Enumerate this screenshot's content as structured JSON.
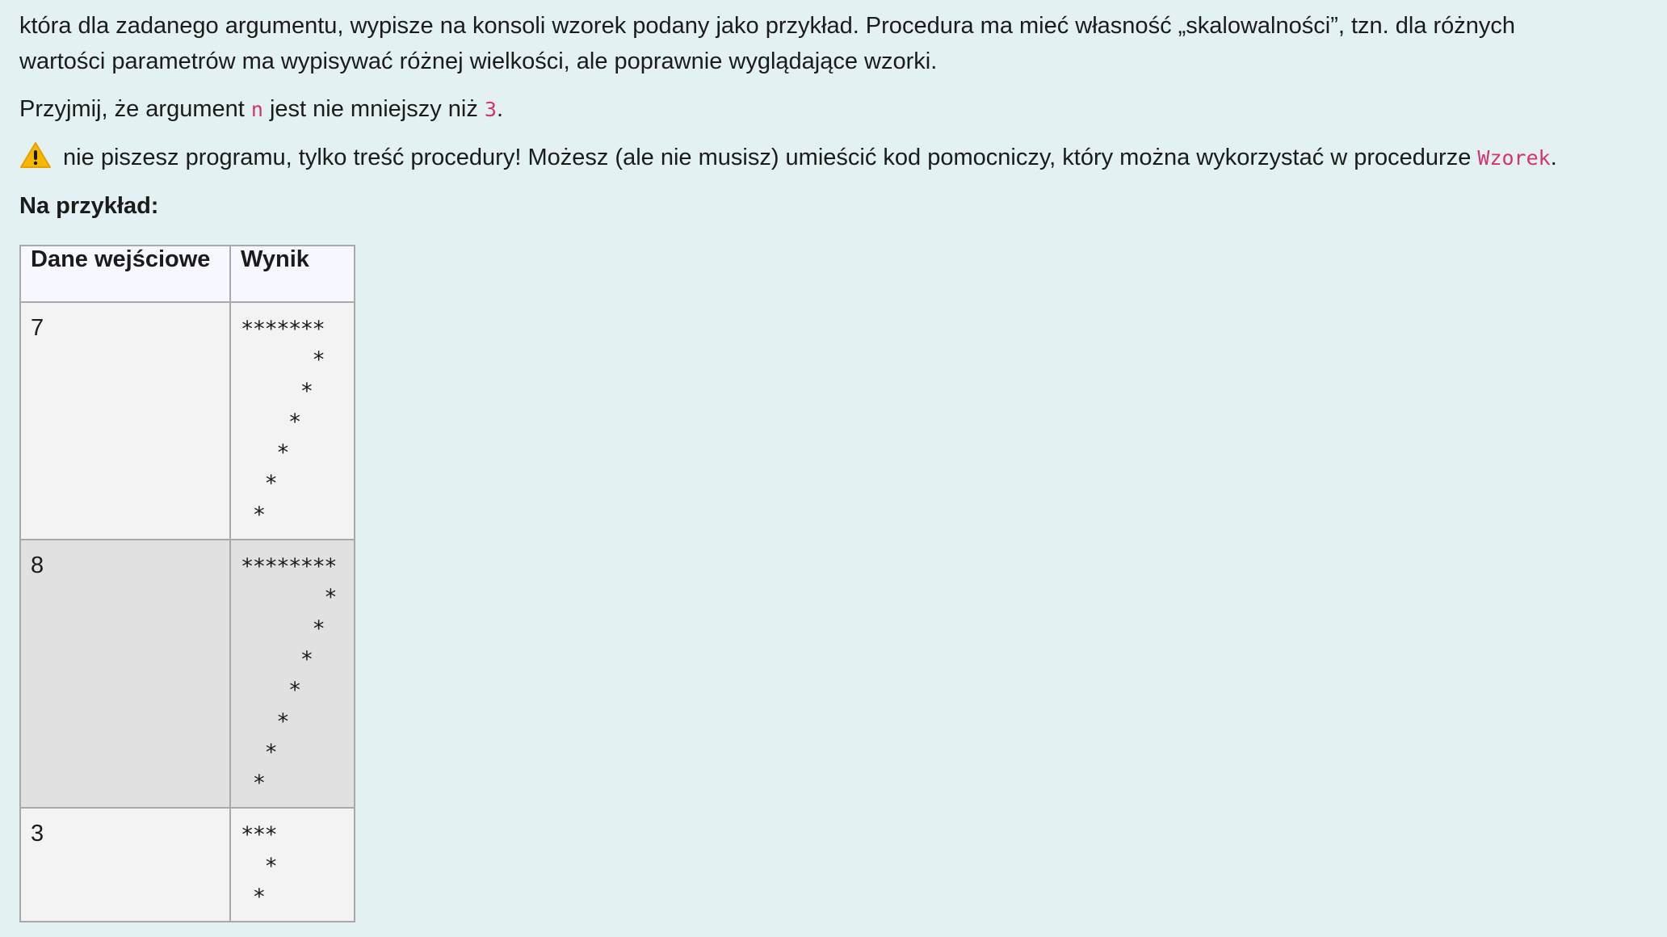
{
  "intro": {
    "line1": "która dla zadanego argumentu, wypisze na konsoli wzorek podany jako przykład. Procedura ma mieć własność „skalowalności”, tzn. dla różnych",
    "line2": "wartości parametrów ma wypisywać różnej wielkości, ale poprawnie wyglądające wzorki."
  },
  "assumption": {
    "before": "Przyjmij, że argument ",
    "code1": "n",
    "middle": " jest nie mniejszy niż ",
    "code2": "3",
    "after": "."
  },
  "warning": {
    "icon": "warning-icon",
    "text": " nie piszesz programu, tylko treść procedury! Możesz (ale nie musisz) umieścić kod pomocniczy, który można wykorzystać w procedurze ",
    "code": "Wzorek",
    "after": "."
  },
  "example_heading": "Na przykład:",
  "table": {
    "headers": [
      "Dane wejściowe",
      "Wynik"
    ],
    "rows": [
      {
        "input": "7",
        "output": "*******\n      *\n     *\n    *\n   *\n  *\n *"
      },
      {
        "input": "8",
        "output": "********\n       *\n      *\n     *\n    *\n   *\n  *\n *"
      },
      {
        "input": "3",
        "output": "***\n  *\n *"
      }
    ]
  },
  "colors": {
    "background": "#e3f1f2",
    "code": "#d6336c",
    "row_light": "#f3f3f3",
    "row_dark": "#e1e1e1",
    "header_bg": "#f7f8ff"
  }
}
